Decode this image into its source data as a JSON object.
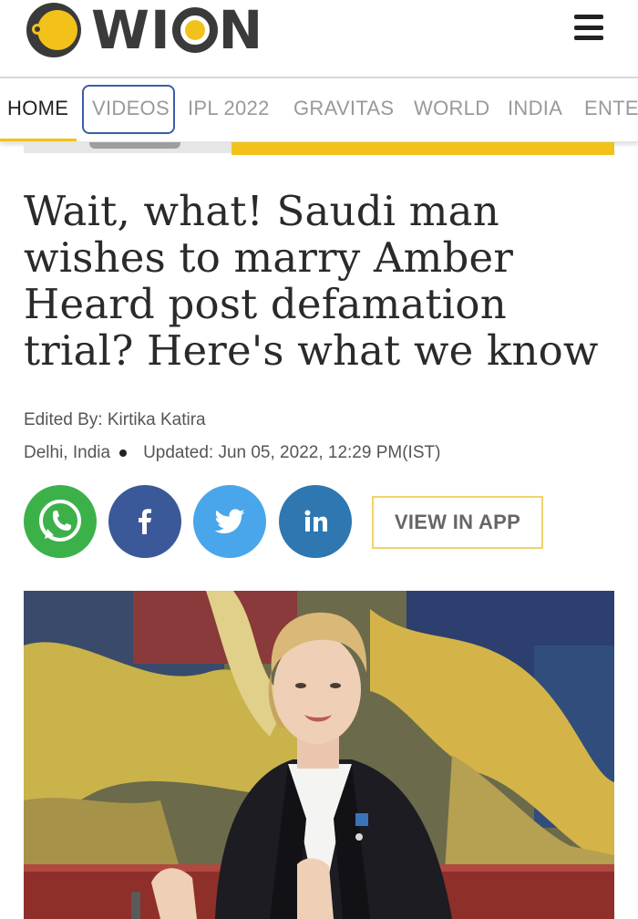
{
  "brand": {
    "name": "WION",
    "accent": "#f2c21b"
  },
  "header": {
    "menu_icon": "hamburger-menu-icon"
  },
  "nav": {
    "items": [
      {
        "label": "HOME",
        "active": true
      },
      {
        "label": "VIDEOS",
        "active": false
      },
      {
        "label": "IPL 2022",
        "active": false
      },
      {
        "label": "GRAVITAS",
        "active": false
      },
      {
        "label": "WORLD",
        "active": false
      },
      {
        "label": "INDIA",
        "active": false
      },
      {
        "label": "ENTE",
        "active": false
      }
    ]
  },
  "article": {
    "headline": "Wait, what! Saudi man wishes to marry Amber Heard post defamation trial? Here's what we know",
    "edited_by": "Edited By: Kirtika Katira",
    "location": "Delhi, India",
    "updated": "Updated: Jun 05, 2022, 12:29 PM(IST)"
  },
  "share": {
    "whatsapp_icon": "whatsapp-icon",
    "facebook_icon": "facebook-icon",
    "twitter_icon": "twitter-icon",
    "linkedin_icon": "linkedin-icon",
    "view_in_app": "VIEW IN APP"
  }
}
